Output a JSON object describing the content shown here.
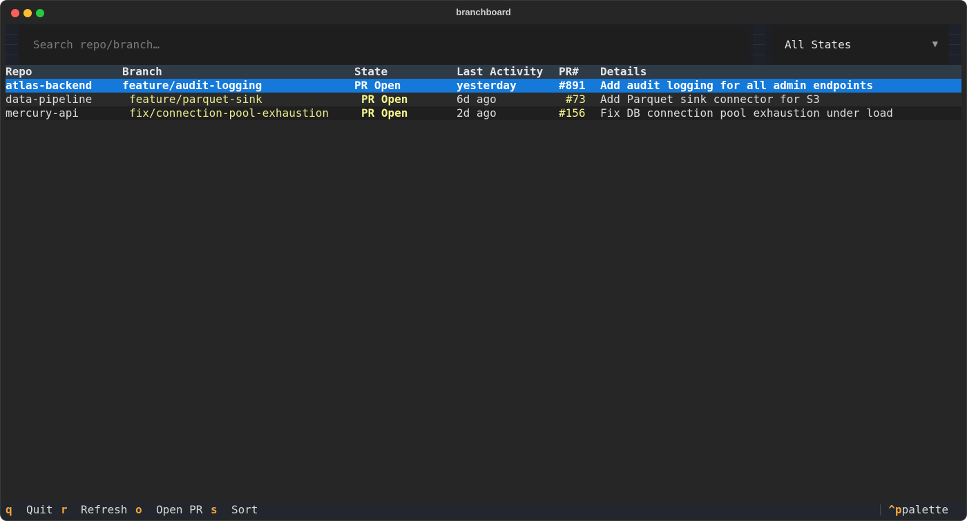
{
  "window": {
    "title": "branchboard"
  },
  "search": {
    "placeholder": "Search repo/branch…",
    "value": ""
  },
  "filter": {
    "selected": "All States",
    "caret": "▼"
  },
  "table": {
    "headers": {
      "repo": "Repo",
      "branch": "Branch",
      "state": "State",
      "last_activity": "Last Activity",
      "pr": "PR#",
      "details": "Details"
    },
    "rows": [
      {
        "repo": "atlas-backend",
        "branch": "feature/audit-logging",
        "state": "PR Open",
        "last_activity": "yesterday",
        "pr": "#891",
        "details": "Add audit logging for all admin endpoints",
        "selected": true
      },
      {
        "repo": "data-pipeline",
        "branch": "feature/parquet-sink",
        "state": "PR Open",
        "last_activity": "6d ago",
        "pr": "#73",
        "details": "Add Parquet sink connector for S3",
        "selected": false
      },
      {
        "repo": "mercury-api",
        "branch": "fix/connection-pool-exhaustion",
        "state": "PR Open",
        "last_activity": "2d ago",
        "pr": "#156",
        "details": "Fix DB connection pool exhaustion under load",
        "selected": false
      }
    ]
  },
  "footer": {
    "bindings": [
      {
        "key": "q",
        "label": "Quit"
      },
      {
        "key": "r",
        "label": "Refresh"
      },
      {
        "key": "o",
        "label": "Open PR"
      },
      {
        "key": "s",
        "label": "Sort"
      }
    ],
    "palette": {
      "key": "^p",
      "label": "palette"
    }
  },
  "colors": {
    "accent_selection": "#1479d8",
    "key_hint": "#f0a43a",
    "branch_text": "#e9e88a",
    "state_text": "#f5f58a",
    "header_bg": "#2f3a47",
    "background": "#262626"
  },
  "icons": {
    "close": "close-dot-icon",
    "minimize": "minimize-dot-icon",
    "maximize": "maximize-dot-icon",
    "dropdown": "chevron-down-icon"
  }
}
